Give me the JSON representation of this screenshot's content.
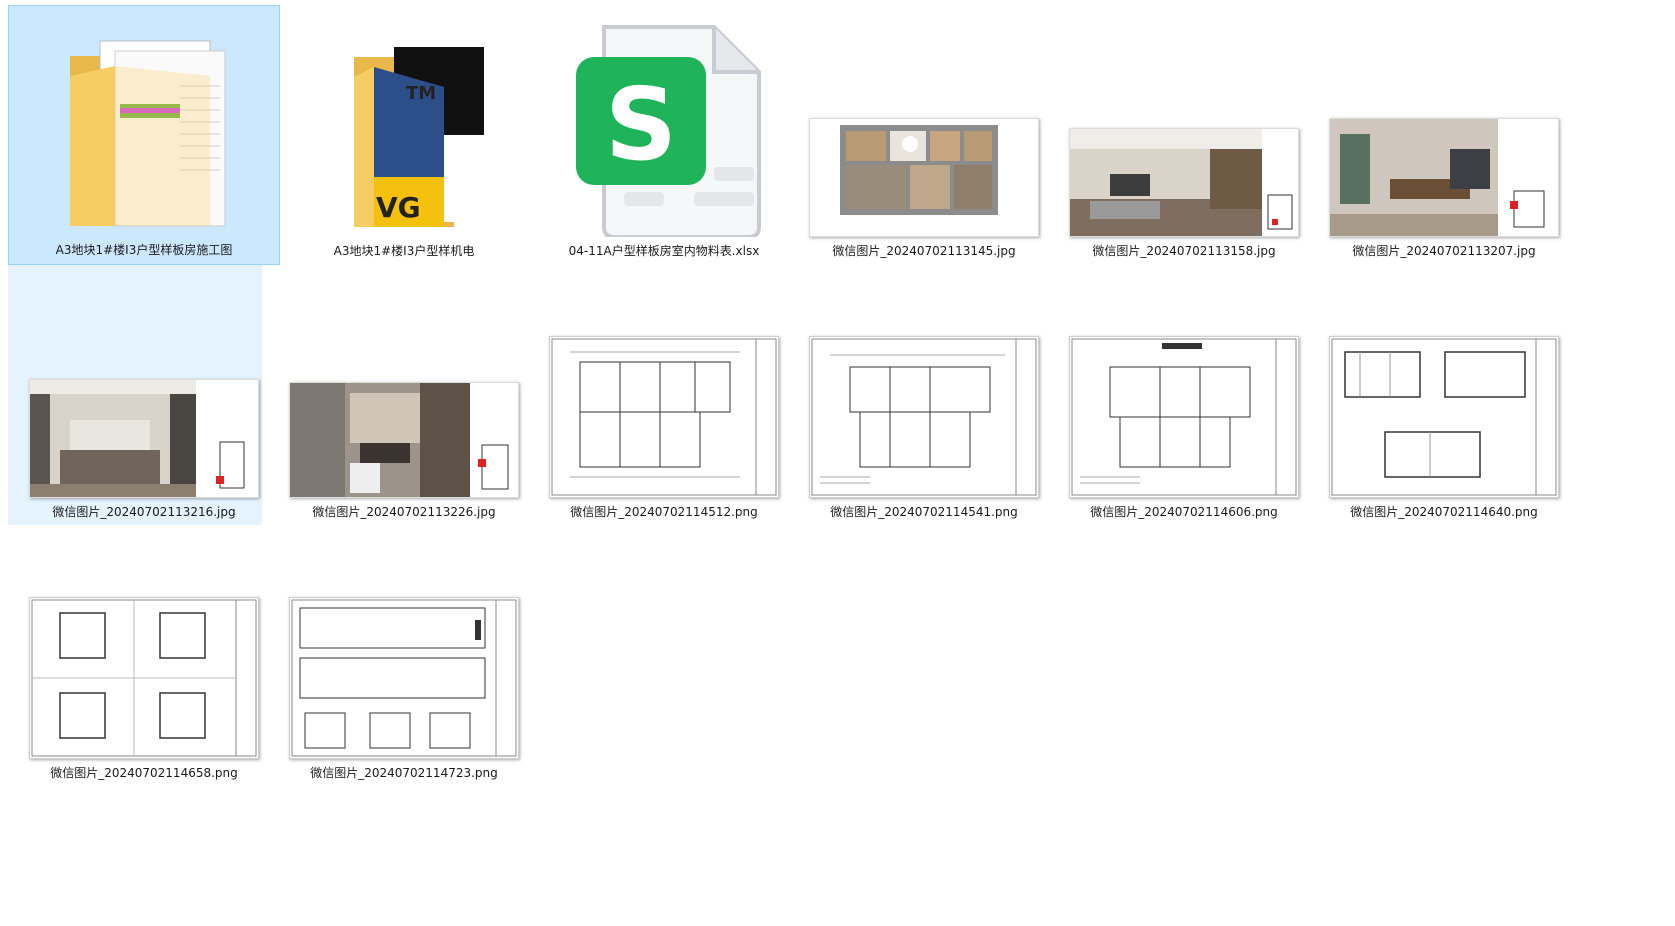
{
  "files": [
    {
      "label": "A3地块1#楼I3户型样板房施工图",
      "kind": "folder-docs",
      "selected": true
    },
    {
      "label": "A3地块1#楼I3户型样机电",
      "kind": "folder-dwg"
    },
    {
      "label": "04-11A户型样板房室内物料表.xlsx",
      "kind": "spreadsheet"
    },
    {
      "label": "微信图片_20240702113145.jpg",
      "kind": "floorplan-color"
    },
    {
      "label": "微信图片_20240702113158.jpg",
      "kind": "render-living"
    },
    {
      "label": "微信图片_20240702113207.jpg",
      "kind": "render-dining"
    },
    {
      "label": "微信图片_20240702113216.jpg",
      "kind": "render-bedroom",
      "selected_soft": true
    },
    {
      "label": "微信图片_20240702113226.jpg",
      "kind": "render-bath"
    },
    {
      "label": "微信图片_20240702114512.png",
      "kind": "drawing-plan"
    },
    {
      "label": "微信图片_20240702114541.png",
      "kind": "drawing-plan"
    },
    {
      "label": "微信图片_20240702114606.png",
      "kind": "drawing-plan"
    },
    {
      "label": "微信图片_20240702114640.png",
      "kind": "drawing-elev"
    },
    {
      "label": "微信图片_20240702114658.png",
      "kind": "drawing-grid"
    },
    {
      "label": "微信图片_20240702114723.png",
      "kind": "drawing-sections"
    }
  ],
  "icons": {
    "spreadsheet_letter": "S",
    "dwg_letters": "VG",
    "dwg_tm": "TM"
  },
  "colors": {
    "selection_bg": "#cce8ff",
    "selection_border": "#99d1ff",
    "folder": "#f5cd62",
    "sheet_green": "#1fb45a"
  }
}
